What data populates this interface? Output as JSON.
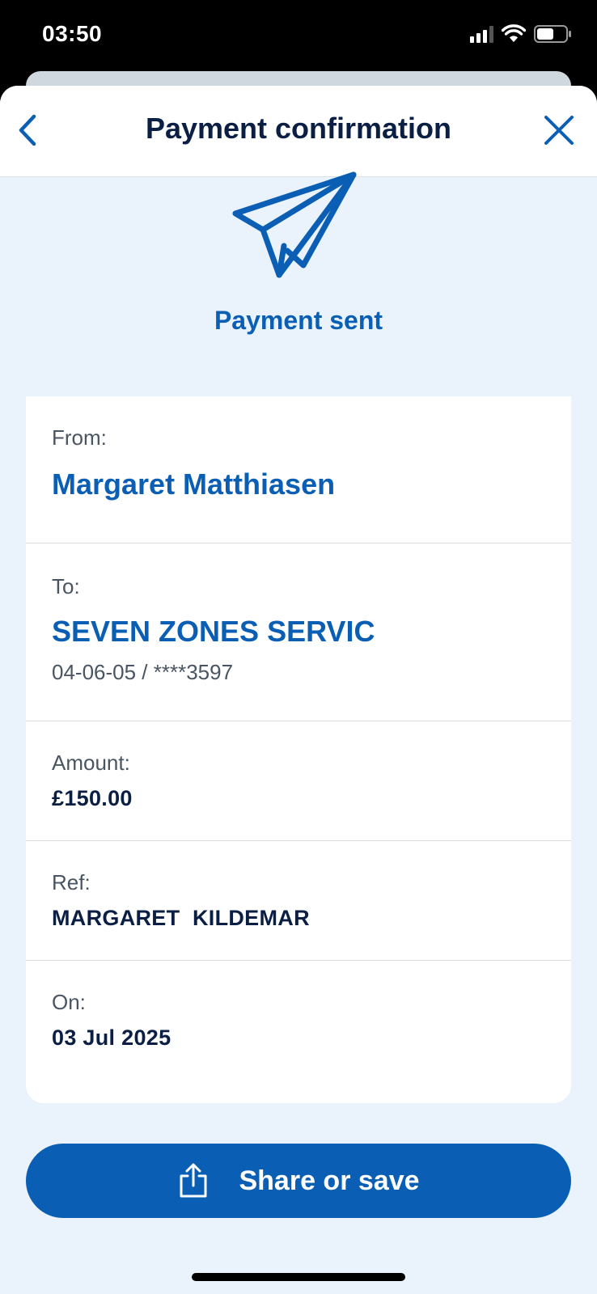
{
  "status_bar": {
    "time": "03:50"
  },
  "nav": {
    "title": "Payment confirmation",
    "back_icon": "chevron-left-icon",
    "close_icon": "close-icon"
  },
  "hero": {
    "icon": "paper-plane-icon",
    "title": "Payment sent"
  },
  "details": {
    "from_label": "From:",
    "from_value": "Margaret Matthiasen",
    "to_label": "To:",
    "to_value": "SEVEN ZONES SERVIC",
    "to_account": "04-06-05 / ****3597",
    "amount_label": "Amount:",
    "amount_value": "£150.00",
    "ref_label": "Ref:",
    "ref_value": "MARGARET  KILDEMAR",
    "on_label": "On:",
    "on_value": "03 Jul 2025"
  },
  "actions": {
    "share_label": "Share or save",
    "share_icon": "share-icon"
  },
  "colors": {
    "accent": "#0a5fb4",
    "text_dark": "#0b1f45",
    "background": "#eaf2fb"
  }
}
